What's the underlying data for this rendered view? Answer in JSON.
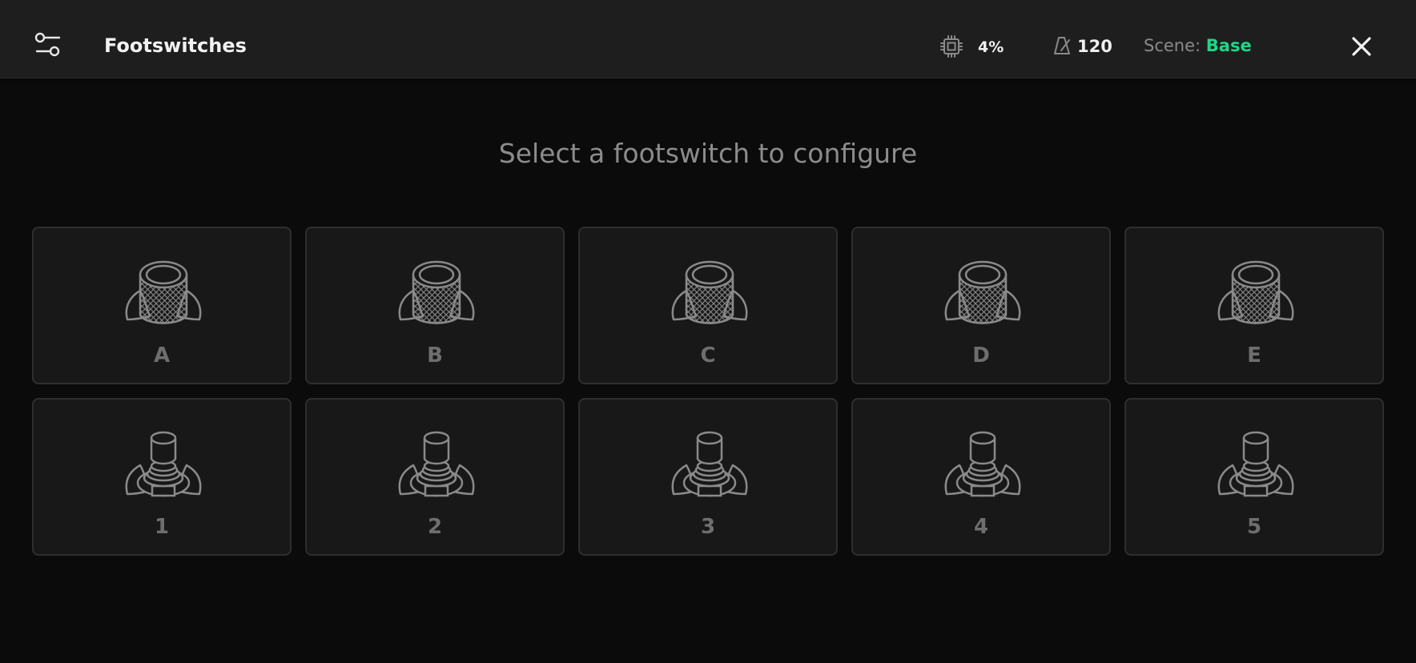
{
  "header": {
    "title": "Footswitches",
    "cpu_value": "4%",
    "tempo_value": "120",
    "scene_label": "Scene:",
    "scene_value": "Base"
  },
  "prompt": "Select a footswitch to configure",
  "footswitches": {
    "row1": [
      {
        "label": "A",
        "icon": "knurled-footswitch-icon"
      },
      {
        "label": "B",
        "icon": "knurled-footswitch-icon"
      },
      {
        "label": "C",
        "icon": "knurled-footswitch-icon"
      },
      {
        "label": "D",
        "icon": "knurled-footswitch-icon"
      },
      {
        "label": "E",
        "icon": "knurled-footswitch-icon"
      }
    ],
    "row2": [
      {
        "label": "1",
        "icon": "stomp-footswitch-icon"
      },
      {
        "label": "2",
        "icon": "stomp-footswitch-icon"
      },
      {
        "label": "3",
        "icon": "stomp-footswitch-icon"
      },
      {
        "label": "4",
        "icon": "stomp-footswitch-icon"
      },
      {
        "label": "5",
        "icon": "stomp-footswitch-icon"
      }
    ]
  },
  "colors": {
    "header_bg": "#1e1e1e",
    "page_bg": "#0b0b0b",
    "card_bg": "#181818",
    "accent_green": "#1ed88a",
    "icon_stroke": "#8a8a8a"
  }
}
